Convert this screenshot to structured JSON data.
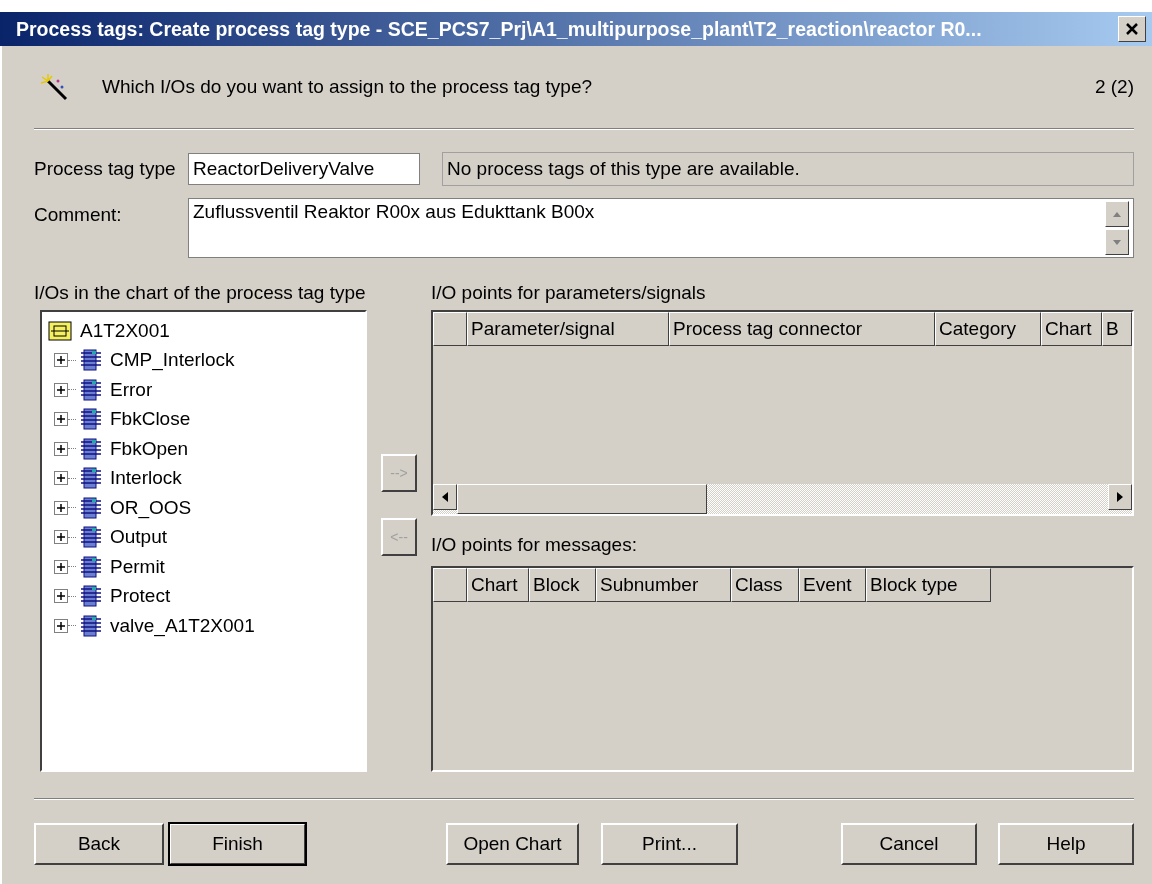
{
  "window": {
    "title": "Process tags: Create process tag type - SCE_PCS7_Prj\\A1_multipurpose_plant\\T2_reaction\\reactor R0..."
  },
  "header": {
    "question": "Which I/Os do you want to assign to the process tag type?",
    "step": "2 (2)"
  },
  "process_tag_type": {
    "label": "Process tag type",
    "value": "ReactorDeliveryValve",
    "info": "No process tags of this type are available."
  },
  "comment": {
    "label": "Comment:",
    "value": "Zuflussventil Reaktor R00x aus Edukttank B00x"
  },
  "tree": {
    "label": "I/Os in the chart of the process tag type",
    "root": {
      "label": "A1T2X001",
      "children": [
        {
          "label": "CMP_Interlock",
          "expanded": false
        },
        {
          "label": "Error",
          "expanded": false
        },
        {
          "label": "FbkClose",
          "expanded": false
        },
        {
          "label": "FbkOpen",
          "expanded": false
        },
        {
          "label": "Interlock",
          "expanded": false
        },
        {
          "label": "OR_OOS",
          "expanded": false
        },
        {
          "label": "Output",
          "expanded": false
        },
        {
          "label": "Permit",
          "expanded": false
        },
        {
          "label": "Protect",
          "expanded": false
        },
        {
          "label": "valve_A1T2X001",
          "expanded": false
        }
      ]
    }
  },
  "move_buttons": [
    {
      "label": "-->",
      "disabled": true
    },
    {
      "label": "<--",
      "disabled": true
    }
  ],
  "parameters_table": {
    "label": "I/O points for parameters/signals",
    "columns": [
      "Parameter/signal",
      "Process tag connector",
      "Category",
      "Chart",
      "B"
    ]
  },
  "messages_table": {
    "label": "I/O points for messages:",
    "columns": [
      "Chart",
      "Block",
      "Subnumber",
      "Class",
      "Event",
      "Block type"
    ]
  },
  "buttons": [
    {
      "label": "Back",
      "default": false
    },
    {
      "label": "Finish",
      "default": true
    },
    {
      "label": "Open Chart",
      "default": false
    },
    {
      "label": "Print...",
      "default": false
    },
    {
      "label": "Cancel",
      "default": false
    },
    {
      "label": "Help",
      "default": false
    }
  ]
}
